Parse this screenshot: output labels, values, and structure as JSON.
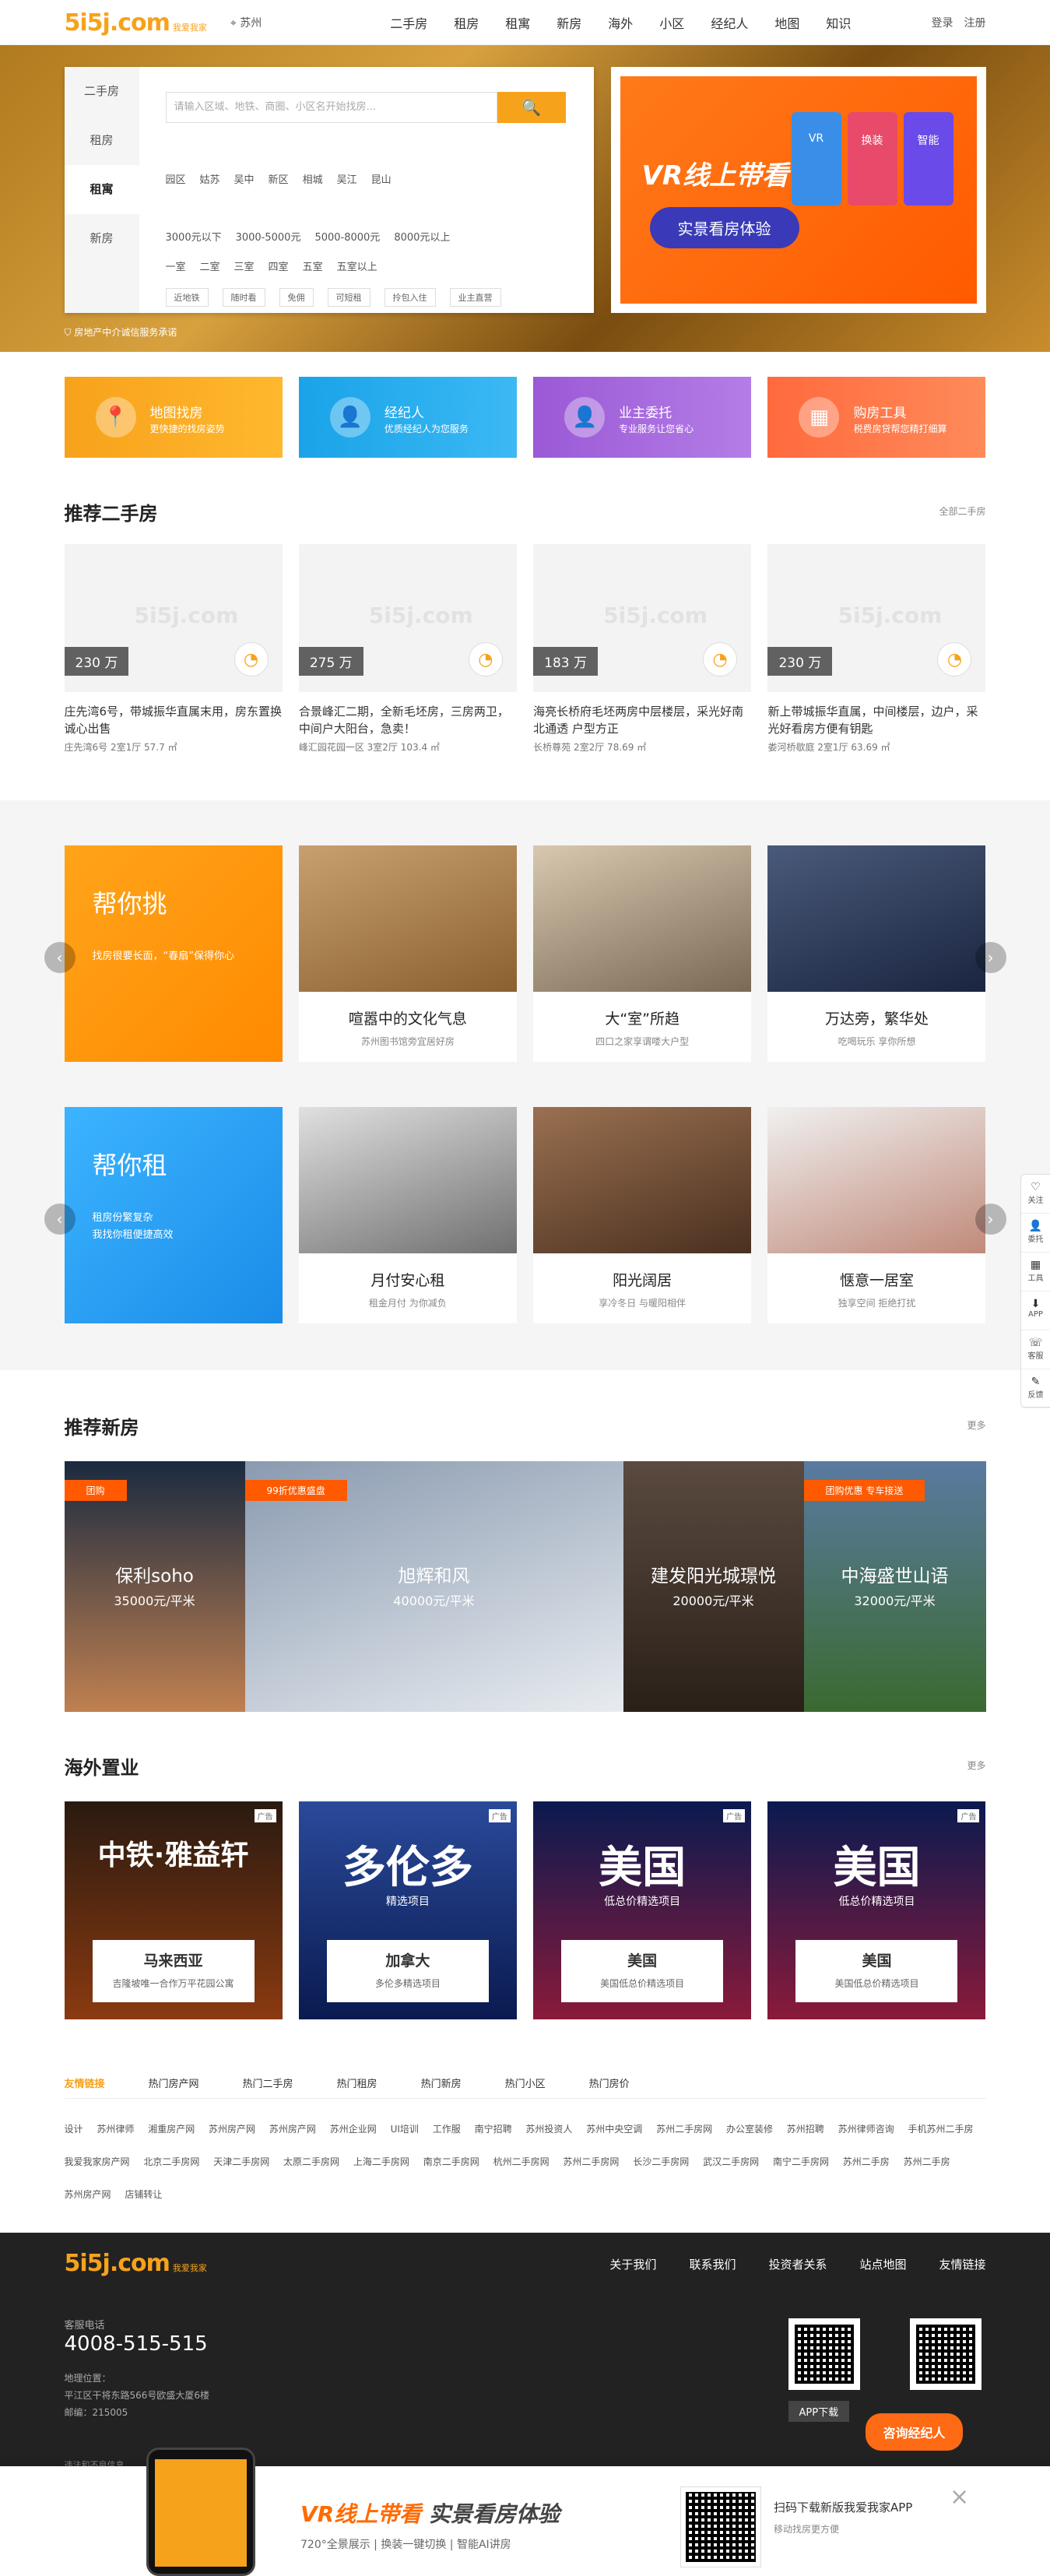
{
  "header": {
    "logo": "5i5j.com",
    "slogan": "我爱我家",
    "city": "苏州",
    "nav": [
      "二手房",
      "租房",
      "租寓",
      "新房",
      "海外",
      "小区",
      "经纪人",
      "地图",
      "知识"
    ],
    "login": "登录",
    "register": "注册"
  },
  "search": {
    "tabs": [
      "二手房",
      "租房",
      "租寓",
      "新房"
    ],
    "placeholder": "请输入区域、地铁、商圈、小区名开始找房...",
    "button": "🔍",
    "areas": [
      "园区",
      "姑苏",
      "吴中",
      "新区",
      "相城",
      "吴江",
      "昆山"
    ],
    "prices": [
      "3000元以下",
      "3000-5000元",
      "5000-8000元",
      "8000元以上"
    ],
    "rooms": [
      "一室",
      "二室",
      "三室",
      "四室",
      "五室",
      "五室以上"
    ],
    "tags": [
      "近地铁",
      "随时看",
      "免佣",
      "可短租",
      "拎包入住",
      "业主直营"
    ],
    "seal": "房地产中介诚信服务承诺"
  },
  "vr": {
    "title": "VR线上带看",
    "button": "实景看房体验",
    "cards": [
      "VR",
      "换装",
      "智能"
    ]
  },
  "services": [
    {
      "title": "地图找房",
      "desc": "更快捷的找房姿势",
      "icon": "📍",
      "color": "#f7a21b"
    },
    {
      "title": "经纪人",
      "desc": "优质经纪人为您服务",
      "icon": "👤",
      "color": "#1aa3e8"
    },
    {
      "title": "业主委托",
      "desc": "专业服务让您省心",
      "icon": "👤",
      "color": "#9b59d6"
    },
    {
      "title": "购房工具",
      "desc": "税费房贷帮您精打细算",
      "icon": "▦",
      "color": "#ff6a3d"
    }
  ],
  "ershou": {
    "title": "推荐二手房",
    "more": "全部二手房",
    "watermark": "5i5j.com",
    "items": [
      {
        "price": "230 万",
        "title": "庄先湾6号，带城振华直属末用，房东置换诚心出售",
        "info": "庄先湾6号  2室1厅  57.7 ㎡"
      },
      {
        "price": "275 万",
        "title": "合景峰汇二期，全新毛坯房，三房两卫，中间户大阳台，急卖！",
        "info": "峰汇园花园一区  3室2厅  103.4 ㎡"
      },
      {
        "price": "183 万",
        "title": "海亮长桥府毛坯两房中层楼层，采光好南北通透 户型方正",
        "info": "长桥尊苑  2室2厅  78.69 ㎡"
      },
      {
        "price": "230 万",
        "title": "新上带城振华直属，中间楼层，边户，采光好看房方便有钥匙",
        "info": "娄河桥歇庭  2室1厅  63.69 ㎡"
      }
    ]
  },
  "choose": {
    "title": "帮你挑",
    "desc": "找房很要长面，“春扇”保得你心",
    "items": [
      {
        "t": "喧嚣中的文化气息",
        "d": "苏州图书馆旁宜居好房"
      },
      {
        "t": "大“室”所趋",
        "d": "四口之家享谓喽大户型"
      },
      {
        "t": "万达旁，繁华处",
        "d": "吃喝玩乐 享你所想"
      }
    ]
  },
  "rent": {
    "title": "帮你租",
    "desc": "租房份繁复杂\n我找你租便捷高效",
    "items": [
      {
        "t": "月付安心租",
        "d": "租金月付 为你减负"
      },
      {
        "t": "阳光阔居",
        "d": "享冷冬日 与暖阳相伴"
      },
      {
        "t": "惬意一居室",
        "d": "独享空间 拒绝打扰"
      }
    ]
  },
  "newhouse": {
    "title": "推荐新房",
    "more": "更多",
    "items": [
      {
        "tag": "团购",
        "name": "保利soho",
        "price": "35000元/平米"
      },
      {
        "tag": "99折优惠盛盘",
        "name": "旭辉和风",
        "price": "40000元/平米"
      },
      {
        "tag": "",
        "name": "建发阳光城璟悦",
        "price": "20000元/平米"
      },
      {
        "tag": "团购优惠 专车接送",
        "name": "中海盛世山语",
        "price": "32000元/平米"
      }
    ]
  },
  "overseas": {
    "title": "海外置业",
    "more": "更多",
    "ad": "广告",
    "items": [
      {
        "big": "中铁·雅益轩",
        "sub": "",
        "name": "马来西亚",
        "desc": "吉隆坡唯一合作万平花园公寓"
      },
      {
        "big": "多伦多",
        "sub": "精选项目",
        "name": "加拿大",
        "desc": "多伦多精选项目"
      },
      {
        "big": "美国",
        "sub": "低总价精选项目",
        "name": "美国",
        "desc": "美国低总价精选项目"
      },
      {
        "big": "美国",
        "sub": "低总价精选项目",
        "name": "美国",
        "desc": "美国低总价精选项目"
      }
    ]
  },
  "links": {
    "tabs": [
      "友情链接",
      "热门房产网",
      "热门二手房",
      "热门租房",
      "热门新房",
      "热门小区",
      "热门房价"
    ],
    "items": [
      "设计",
      "苏州律师",
      "湘重房产网",
      "苏州房产网",
      "苏州房产网",
      "苏州企业网",
      "UI培训",
      "工作服",
      "南宁招聘",
      "苏州投资人",
      "苏州中央空调",
      "苏州二手房网",
      "办公室装修",
      "苏州招聘",
      "苏州律师咨询",
      "手机苏州二手房",
      "我爱我家房产网",
      "北京二手房网",
      "天津二手房网",
      "太原二手房网",
      "上海二手房网",
      "南京二手房网",
      "杭州二手房网",
      "苏州二手房网",
      "长沙二手房网",
      "武汉二手房网",
      "南宁二手房网",
      "苏州二手房",
      "苏州二手房",
      "苏州房产网",
      "店铺转让"
    ]
  },
  "footer": {
    "nav": [
      "关于我们",
      "联系我们",
      "投资者关系",
      "站点地图",
      "友情链接"
    ],
    "hotline_label": "客服电话",
    "hotline": "4008-515-515",
    "addr_label": "地理位置：",
    "addr": "平江区干将东路566号欧盛大厦6楼",
    "zip": "邮编：215005",
    "app": "APP下载",
    "copyright": "违法和不良信息",
    "consult": "咨询经纪人"
  },
  "bottombar": {
    "vr": "VR线上带看",
    "vr2": "实景看房体验",
    "sub": "720°全景展示 | 换装一键切换 | 智能AI讲房",
    "t1": "扫码下载新版我爱我家APP",
    "t2": "移动找房更方便",
    "close": "×"
  },
  "side": [
    {
      "i": "♡",
      "t": "关注"
    },
    {
      "i": "👤",
      "t": "委托"
    },
    {
      "i": "▦",
      "t": "工具"
    },
    {
      "i": "⬇",
      "t": "APP"
    },
    {
      "i": "☏",
      "t": "客服"
    },
    {
      "i": "✎",
      "t": "反馈"
    }
  ]
}
